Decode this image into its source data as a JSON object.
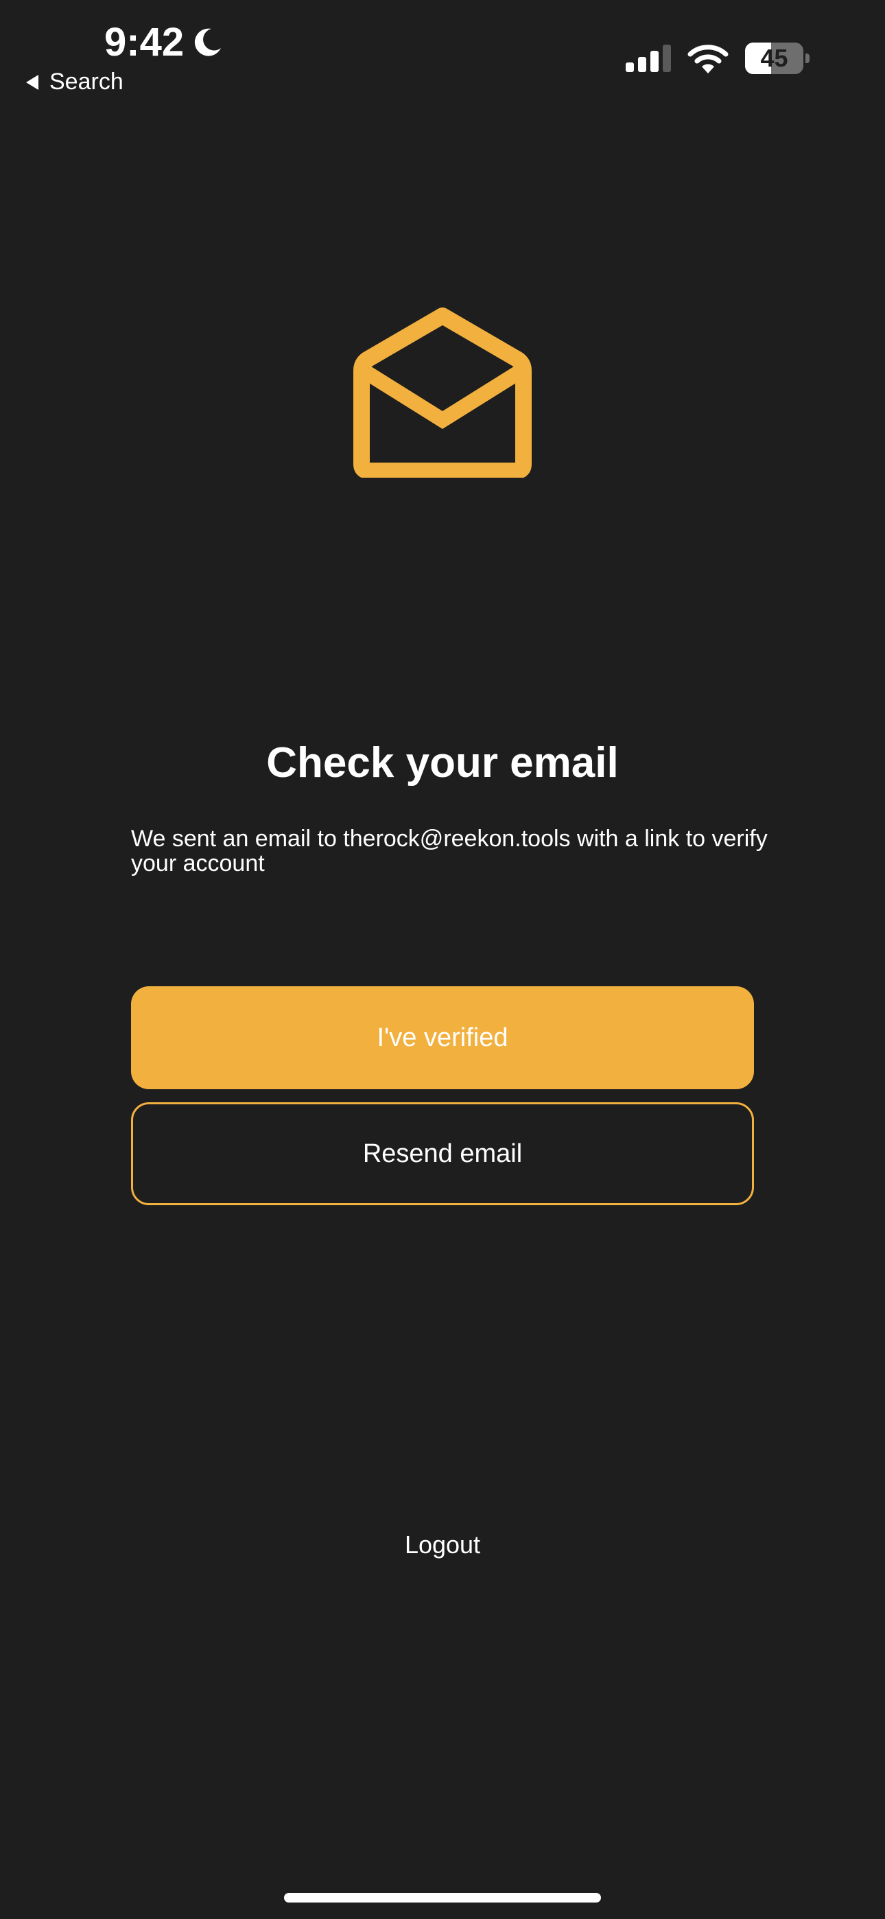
{
  "status_bar": {
    "time": "9:42",
    "back_label": "Search",
    "battery_level": "45",
    "battery_fraction": 0.45,
    "moon_icon": "moon-icon",
    "signal_icon": "cellular-signal-icon",
    "wifi_icon": "wifi-icon"
  },
  "main": {
    "icon": "envelope-open-icon",
    "title": "Check your email",
    "message": "We sent an email to therock@reekon.tools with a link to verify your account"
  },
  "buttons": {
    "primary_label": "I've verified",
    "secondary_label": "Resend email",
    "logout_label": "Logout"
  },
  "colors": {
    "background": "#1e1e1e",
    "accent": "#f2b03f",
    "text": "#ffffff"
  }
}
